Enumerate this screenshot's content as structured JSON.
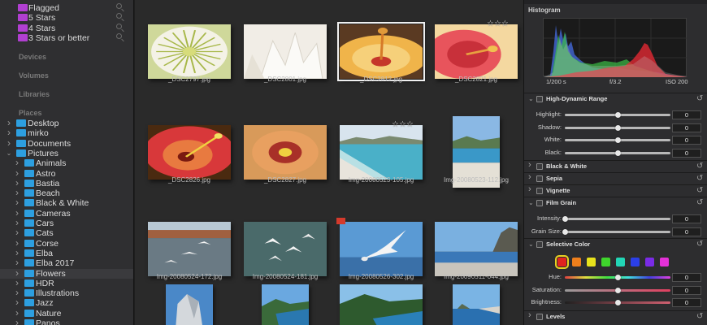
{
  "sidebar": {
    "smart_albums": [
      {
        "label": "Flagged",
        "color": "#b13fd1"
      },
      {
        "label": "5 Stars",
        "color": "#b13fd1"
      },
      {
        "label": "4 Stars",
        "color": "#b13fd1"
      },
      {
        "label": "3 Stars or better",
        "color": "#b13fd1"
      }
    ],
    "sections": {
      "devices": "Devices",
      "volumes": "Volumes",
      "libraries": "Libraries",
      "places": "Places"
    },
    "places": [
      {
        "label": "Desktop",
        "level": 0,
        "expanded": false
      },
      {
        "label": "mirko",
        "level": 0,
        "expanded": false
      },
      {
        "label": "Documents",
        "level": 0,
        "expanded": false
      },
      {
        "label": "Pictures",
        "level": 0,
        "expanded": true
      },
      {
        "label": "Animals",
        "level": 1,
        "expanded": false
      },
      {
        "label": "Astro",
        "level": 1,
        "expanded": false
      },
      {
        "label": "Bastia",
        "level": 1,
        "expanded": false
      },
      {
        "label": "Beach",
        "level": 1,
        "expanded": false
      },
      {
        "label": "Black & White",
        "level": 1,
        "expanded": false
      },
      {
        "label": "Cameras",
        "level": 1,
        "expanded": false
      },
      {
        "label": "Cars",
        "level": 1,
        "expanded": false
      },
      {
        "label": "Cats",
        "level": 1,
        "expanded": false
      },
      {
        "label": "Corse",
        "level": 1,
        "expanded": false
      },
      {
        "label": "Elba",
        "level": 1,
        "expanded": false
      },
      {
        "label": "Elba 2017",
        "level": 1,
        "expanded": false
      },
      {
        "label": "Flowers",
        "level": 1,
        "expanded": false,
        "selected": true
      },
      {
        "label": "HDR",
        "level": 1,
        "expanded": false
      },
      {
        "label": "Illustrations",
        "level": 1,
        "expanded": false
      },
      {
        "label": "Jazz",
        "level": 1,
        "expanded": false
      },
      {
        "label": "Nature",
        "level": 1,
        "expanded": false
      },
      {
        "label": "Panos",
        "level": 1,
        "expanded": false
      }
    ]
  },
  "grid": {
    "items": [
      {
        "name": "_DSC2797.jpg",
        "stars": 0,
        "flagged": false,
        "selected": false,
        "art": "flower-white"
      },
      {
        "name": "_DSC2801.jpg",
        "stars": 0,
        "flagged": false,
        "selected": false,
        "art": "flower-cream"
      },
      {
        "name": "_DSC2812.jpg",
        "stars": 0,
        "flagged": false,
        "selected": true,
        "art": "hibiscus-yellow"
      },
      {
        "name": "_DSC2821.jpg",
        "stars": 3,
        "flagged": false,
        "selected": false,
        "art": "hibiscus-pink"
      },
      {
        "name": "_DSC2826.jpg",
        "stars": 0,
        "flagged": false,
        "selected": false,
        "art": "hibiscus-red"
      },
      {
        "name": "_DSC2827.jpg",
        "stars": 0,
        "flagged": false,
        "selected": false,
        "art": "hibiscus-orange"
      },
      {
        "name": "Img-20080523-105.jpg",
        "stars": 3,
        "flagged": false,
        "selected": false,
        "art": "beach"
      },
      {
        "name": "Img-20080523-112.jpg",
        "stars": 0,
        "flagged": false,
        "selected": false,
        "art": "beach-portrait"
      },
      {
        "name": "Img-20080524-172.jpg",
        "stars": 0,
        "flagged": false,
        "selected": false,
        "art": "gulls-harbor"
      },
      {
        "name": "Img-20080524-181.jpg",
        "stars": 0,
        "flagged": false,
        "selected": false,
        "art": "gulls-water"
      },
      {
        "name": "Img-20080526-302.jpg",
        "stars": 0,
        "flagged": true,
        "selected": false,
        "art": "gull-sky"
      },
      {
        "name": "Img-20090511-044.jpg",
        "stars": 0,
        "flagged": false,
        "selected": false,
        "art": "coast"
      },
      {
        "name": "",
        "stars": 0,
        "flagged": false,
        "selected": false,
        "art": "rock-portrait"
      },
      {
        "name": "",
        "stars": 0,
        "flagged": false,
        "selected": false,
        "art": "cove-portrait"
      },
      {
        "name": "",
        "stars": 0,
        "flagged": false,
        "selected": false,
        "art": "cove-wide"
      },
      {
        "name": "",
        "stars": 0,
        "flagged": false,
        "selected": false,
        "art": "bay-portrait"
      }
    ]
  },
  "panel": {
    "histogram": {
      "title": "Histogram",
      "shutter": "1/200 s",
      "aperture": "f/3.2",
      "iso": "ISO 200"
    },
    "hdr": {
      "title": "High-Dynamic Range",
      "sliders": [
        {
          "label": "Highlight:",
          "value": "0",
          "level": 0.5
        },
        {
          "label": "Shadow:",
          "value": "0",
          "level": 0.5
        },
        {
          "label": "White:",
          "value": "0",
          "level": 0.5
        },
        {
          "label": "Black:",
          "value": "0",
          "level": 0.5
        }
      ]
    },
    "bw": {
      "title": "Black & White"
    },
    "sepia": {
      "title": "Sepia"
    },
    "vignette": {
      "title": "Vignette"
    },
    "film_grain": {
      "title": "Film Grain",
      "sliders": [
        {
          "label": "Intensity:",
          "value": "0",
          "level": 0.0
        },
        {
          "label": "Grain Size:",
          "value": "0",
          "level": 0.0
        }
      ]
    },
    "selective_color": {
      "title": "Selective Color",
      "swatches": [
        "#e0231f",
        "#ee7f1c",
        "#e8e21c",
        "#3fd52c",
        "#22d6b6",
        "#2b3fe8",
        "#7a2be6",
        "#e431d8"
      ],
      "selected_swatch": 0,
      "sliders": [
        {
          "label": "Hue:",
          "value": "0",
          "level": 0.5
        },
        {
          "label": "Saturation:",
          "value": "0",
          "level": 0.5
        },
        {
          "label": "Brightness:",
          "value": "0",
          "level": 0.5
        }
      ]
    },
    "levels": {
      "title": "Levels"
    }
  }
}
